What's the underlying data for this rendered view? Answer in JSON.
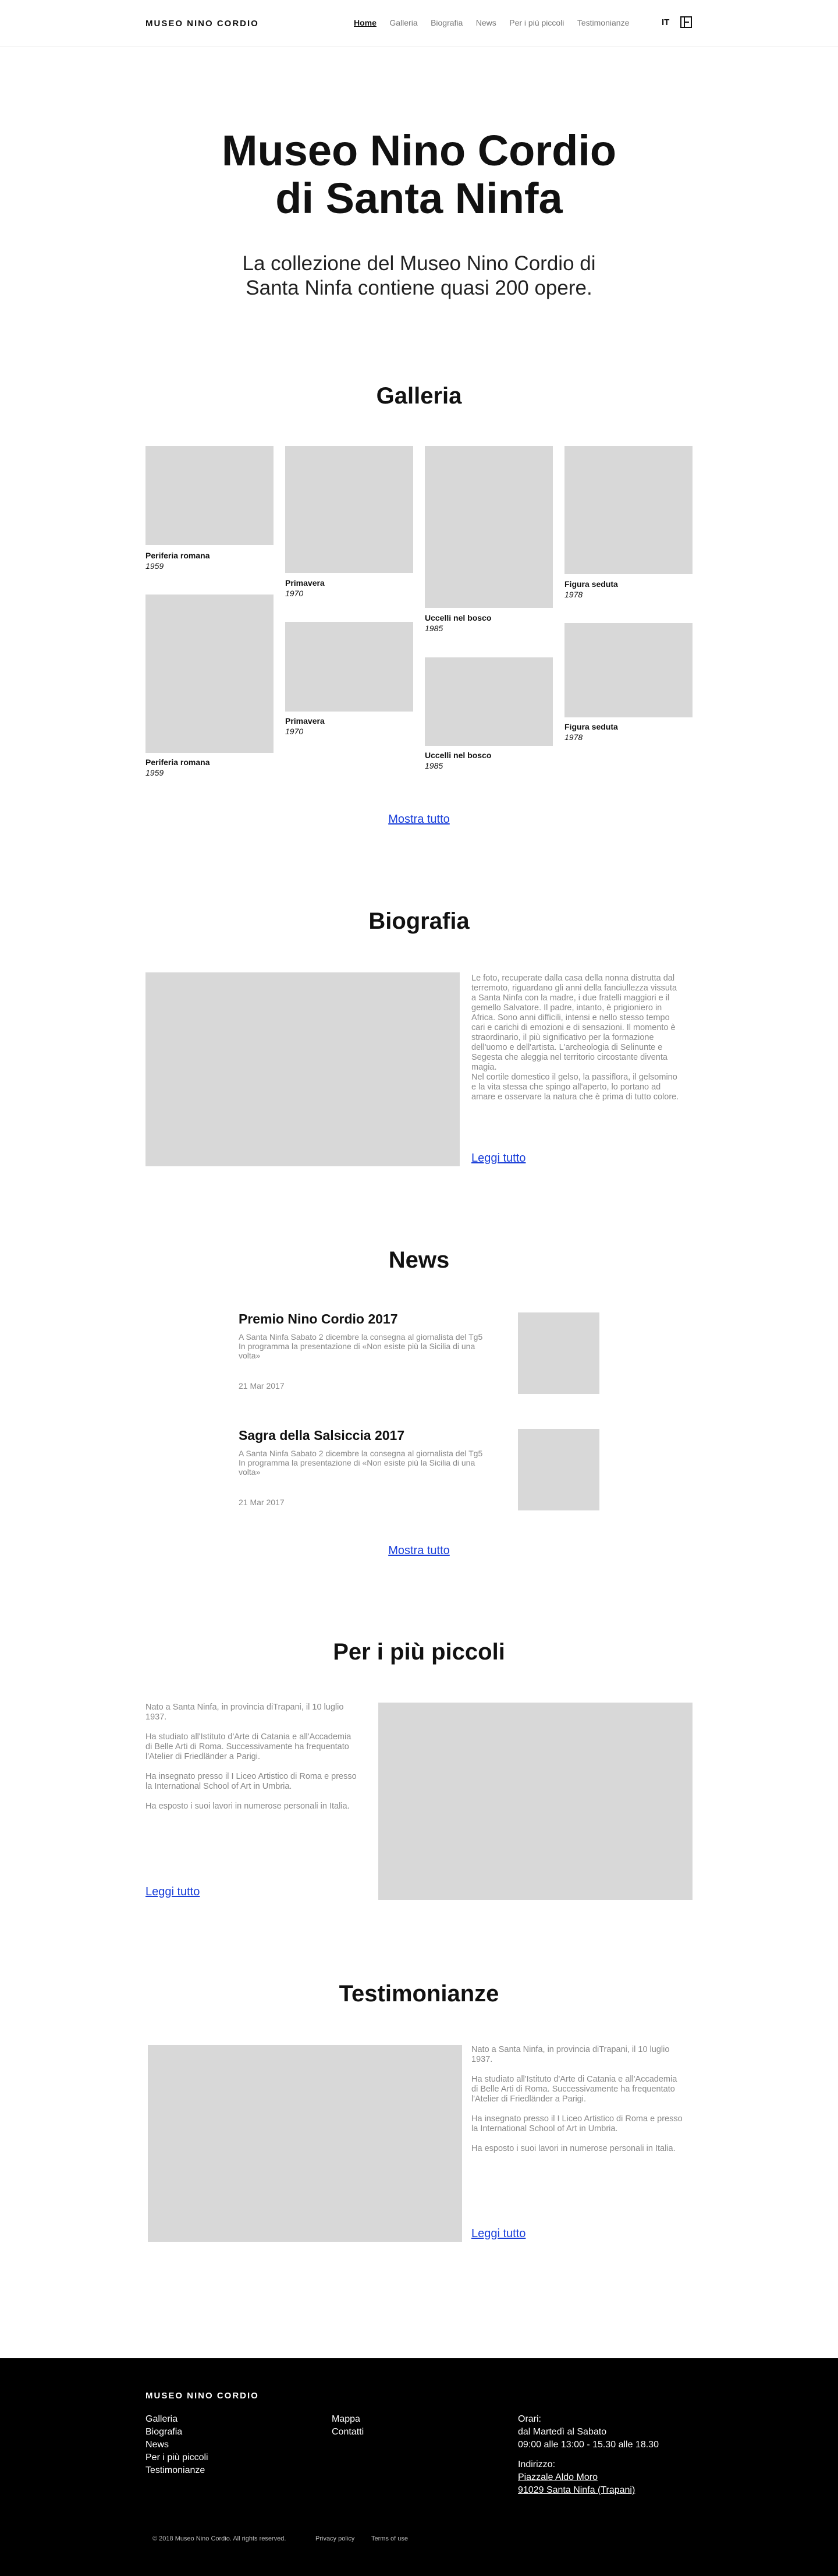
{
  "header": {
    "brand": "MUSEO NINO CORDIO",
    "nav": [
      "Home",
      "Galleria",
      "Biografia",
      "News",
      "Per i più piccoli",
      "Testimonianze"
    ],
    "lang": "IT",
    "menu_icon": "menu-square-icon"
  },
  "hero": {
    "title_line1": "Museo Nino Cordio",
    "title_line2": "di Santa Ninfa",
    "subtitle_line1": "La collezione del Museo Nino Cordio di",
    "subtitle_line2": "Santa Ninfa contiene quasi 200 opere."
  },
  "galleria": {
    "title": "Galleria",
    "items": [
      {
        "title": "Periferia romana",
        "year": "1959"
      },
      {
        "title": "Primavera",
        "year": "1970"
      },
      {
        "title": "Uccelli nel bosco",
        "year": "1985"
      },
      {
        "title": "Figura seduta",
        "year": "1978"
      },
      {
        "title": "Periferia romana",
        "year": "1959"
      },
      {
        "title": "Primavera",
        "year": "1970"
      },
      {
        "title": "Uccelli nel bosco",
        "year": "1985"
      },
      {
        "title": "Figura seduta",
        "year": "1978"
      }
    ],
    "more": "Mostra tutto"
  },
  "biografia": {
    "title": "Biografia",
    "lines": [
      "Le foto, recuperate dalla casa della nonna distrutta dal",
      "terremoto, riguardano gli anni della fanciullezza vissuta",
      "a Santa Ninfa con la madre, i due fratelli maggiori e il",
      "gemello Salvatore. Il padre, intanto, è prigioniero in",
      "Africa. Sono anni difficili, intensi e nello stesso tempo",
      "cari e carichi di emozioni e di sensazioni. Il momento è",
      "straordinario, il più significativo per la formazione",
      "dell'uomo e dell'artista. L'archeologia di Selinunte e",
      "Segesta che aleggia nel territorio circostante diventa",
      "magia.",
      "Nel cortile domestico il gelso, la passiflora, il gelsomino",
      "e la vita stessa che spingo all'aperto, lo portano ad",
      "amare e osservare la natura che è prima di tutto colore."
    ],
    "more": "Leggi tutto"
  },
  "news": {
    "title": "News",
    "items": [
      {
        "title": "Premio Nino Cordio 2017",
        "line1": "A Santa Ninfa Sabato 2 dicembre la consegna al giornalista del Tg5",
        "line2": "In programma la presentazione di «Non esiste più la Sicilia di una",
        "line3": "volta»",
        "date": "21 Mar 2017"
      },
      {
        "title": "Sagra della Salsiccia 2017",
        "line1": "A Santa Ninfa Sabato 2 dicembre la consegna al giornalista del Tg5",
        "line2": "In programma la presentazione di «Non esiste più la Sicilia di una",
        "line3": "volta»",
        "date": "21 Mar 2017"
      }
    ],
    "more": "Mostra tutto"
  },
  "piccoli": {
    "title": "Per i più piccoli",
    "p1a": "Nato a Santa Ninfa, in provincia diTrapani, il 10 luglio",
    "p1b": "1937.",
    "p2a": "Ha studiato all'Istituto d'Arte di Catania e all'Accademia",
    "p2b": "di Belle Arti di Roma. Successivamente ha frequentato",
    "p2c": "l'Atelier di Friedländer a Parigi.",
    "p3a": "Ha insegnato presso il I Liceo Artistico di Roma e presso",
    "p3b": "la International School of Art in Umbria.",
    "p4": "Ha esposto i suoi lavori in numerose personali in Italia.",
    "more": "Leggi tutto"
  },
  "testimonianze": {
    "title": "Testimonianze",
    "p1a": "Nato a Santa Ninfa, in provincia diTrapani, il 10 luglio",
    "p1b": "1937.",
    "p2a": "Ha studiato all'Istituto d'Arte di Catania e all'Accademia",
    "p2b": "di Belle Arti di Roma. Successivamente ha frequentato",
    "p2c": "l'Atelier di Friedländer a Parigi.",
    "p3a": "Ha insegnato presso il I Liceo Artistico di Roma e presso",
    "p3b": "la International School of Art in Umbria.",
    "p4": "Ha esposto i suoi lavori in numerose personali in Italia.",
    "more": "Leggi tutto"
  },
  "footer": {
    "brand": "MUSEO NINO CORDIO",
    "col1": [
      "Galleria",
      "Biografia",
      "News",
      "Per i più piccoli",
      "Testimonianze"
    ],
    "col2": [
      "Mappa",
      "Contatti"
    ],
    "orari_label": "Orari:",
    "orari_days": "dal Martedì al Sabato",
    "orari_hours": "09:00 alle 13:00 - 15.30 alle 18.30",
    "indirizzo_label": "Indirizzo:",
    "address1": "Piazzale Aldo Moro",
    "address2": "91029 Santa Ninfa (Trapani)",
    "copyright": "© 2018 Museo Nino Cordio. All rights reserved.",
    "privacy": "Privacy policy",
    "terms": "Terms of use"
  },
  "colors": {
    "accent_link": "#1a3fd9",
    "placeholder": "#d8d8d8",
    "footer_bg": "#000000"
  }
}
